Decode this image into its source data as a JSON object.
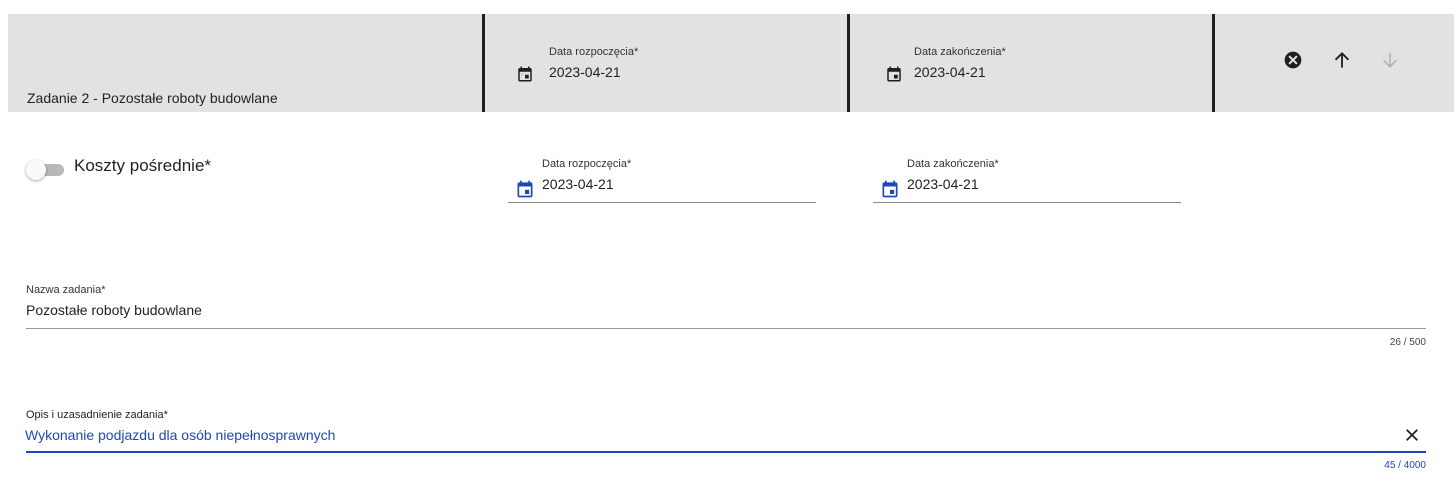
{
  "header": {
    "task_title": "Zadanie 2 - Pozostałe roboty budowlane",
    "start_date": {
      "label": "Data rozpoczęcia*",
      "value": "2023-04-21",
      "icon": "calendar-icon"
    },
    "end_date": {
      "label": "Data zakończenia*",
      "value": "2023-04-21",
      "icon": "calendar-icon"
    },
    "actions": [
      {
        "name": "remove",
        "icon": "cancel-circle-icon",
        "enabled": true
      },
      {
        "name": "move-up",
        "icon": "arrow-up-icon",
        "enabled": true
      },
      {
        "name": "move-down",
        "icon": "arrow-down-icon",
        "enabled": false
      }
    ]
  },
  "body": {
    "indirect_costs": {
      "label": "Koszty pośrednie*",
      "checked": false
    },
    "start_date": {
      "label": "Data rozpoczęcia*",
      "value": "2023-04-21",
      "icon": "calendar-icon"
    },
    "end_date": {
      "label": "Data zakończenia*",
      "value": "2023-04-21",
      "icon": "calendar-icon"
    },
    "task_name": {
      "label": "Nazwa zadania*",
      "value": "Pozostałe roboty budowlane",
      "counter": "26 / 500"
    },
    "task_description": {
      "label": "Opis i uzasadnienie zadania*",
      "value": "Wykonanie podjazdu dla osób niepełnosprawnych",
      "counter": "45 / 4000",
      "clear_icon": "close-icon"
    }
  },
  "colors": {
    "header_bg": "#e2e2e2",
    "divider": "#1f1f1f",
    "accent": "#1f47b8",
    "icon_dark": "#1f1f1f",
    "icon_disabled": "#b0b0b0"
  }
}
